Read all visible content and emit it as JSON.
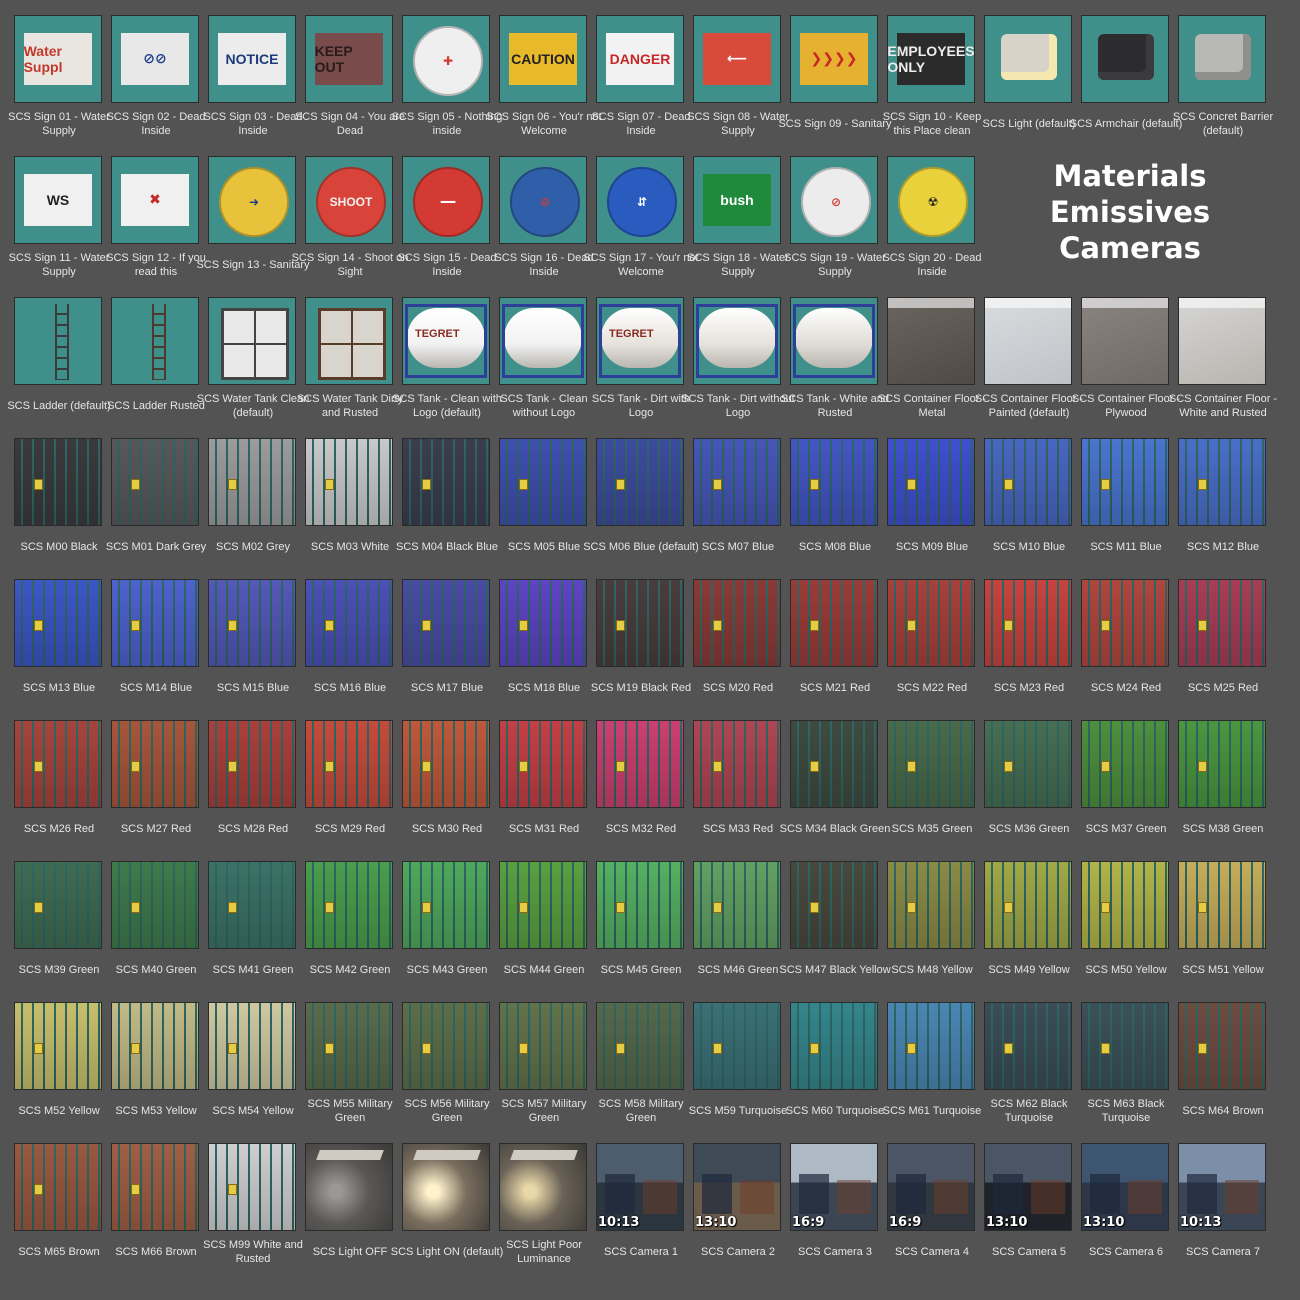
{
  "heading": [
    "Materials",
    "Emissives",
    "Cameras"
  ],
  "items": [
    {
      "label": "SCS Sign 01 - Water Supply",
      "kind": "sign-panel",
      "color": "#e9e6e1",
      "ink": "#c0392b",
      "text": "Water Suppl"
    },
    {
      "label": "SCS Sign 02 - Dead Inside",
      "kind": "sign-panel",
      "color": "#e8e8e8",
      "ink": "#1f3f8a",
      "text": "⊘⊘"
    },
    {
      "label": "SCS Sign 03 - Dead Inside",
      "kind": "sign-panel",
      "color": "#ececec",
      "ink": "#1d3a7a",
      "text": "NOTICE"
    },
    {
      "label": "SCS Sign 04 - You are Dead",
      "kind": "sign-panel",
      "color": "#7a4b4b",
      "ink": "#2a1b1b",
      "text": "KEEP OUT"
    },
    {
      "label": "SCS Sign 05 - Nothing inside",
      "kind": "sign-round",
      "color": "#efefef",
      "ink": "#d23b36",
      "text": "✚"
    },
    {
      "label": "SCS Sign 06 - You'r not Welcome",
      "kind": "sign-panel",
      "color": "#e8b92a",
      "ink": "#222",
      "text": "CAUTION"
    },
    {
      "label": "SCS Sign 07 - Dead Inside",
      "kind": "sign-panel",
      "color": "#f2f2f2",
      "ink": "#c62828",
      "text": "DANGER"
    },
    {
      "label": "SCS Sign 08 - Water Supply",
      "kind": "sign-panel",
      "color": "#d84a3a",
      "ink": "#ffffff",
      "text": "⟵"
    },
    {
      "label": "SCS Sign 09 - Sanitary",
      "kind": "sign-panel",
      "color": "#e6b130",
      "ink": "#c62828",
      "text": "❯❯❯❯"
    },
    {
      "label": "SCS Sign 10 - Keep this Place clean",
      "kind": "sign-panel",
      "color": "#2b2b2b",
      "ink": "#eeeeee",
      "text": "EMPLOYEES ONLY"
    },
    {
      "label": "SCS Light (default)",
      "kind": "thing",
      "color": "#d7d3c9",
      "ink": "#f4e7b0",
      "text": ""
    },
    {
      "label": "SCS Armchair (default)",
      "kind": "thing",
      "color": "#2c2c2e",
      "ink": "#3b3b3d",
      "text": ""
    },
    {
      "label": "SCS Concret Barrier (default)",
      "kind": "thing",
      "color": "#b8b8b5",
      "ink": "#8f8f8c",
      "text": ""
    },
    {
      "label": "SCS Sign 11 - Water Supply",
      "kind": "sign-panel",
      "color": "#f0f0f0",
      "ink": "#222",
      "text": "WS"
    },
    {
      "label": "SCS Sign 12 - If you read this",
      "kind": "sign-panel",
      "color": "#f0f0f0",
      "ink": "#c62828",
      "text": "✖"
    },
    {
      "label": "SCS Sign 13 - Sanitary",
      "kind": "sign-round",
      "color": "#e8c23a",
      "ink": "#1f3f8a",
      "text": "➜"
    },
    {
      "label": "SCS Sign 14 - Shoot on Sight",
      "kind": "sign-round",
      "color": "#d9443a",
      "ink": "#f2f2f2",
      "text": "SHOOT"
    },
    {
      "label": "SCS Sign 15 - Dead Inside",
      "kind": "sign-round",
      "color": "#d33a33",
      "ink": "#ffffff",
      "text": "━━"
    },
    {
      "label": "SCS Sign 16 - Dead Inside",
      "kind": "sign-round",
      "color": "#2f5fa8",
      "ink": "#d33a33",
      "text": "⊘"
    },
    {
      "label": "SCS Sign 17 - You'r not Welcome",
      "kind": "sign-round",
      "color": "#2a5cc0",
      "ink": "#ffffff",
      "text": "⇵"
    },
    {
      "label": "SCS Sign 18 - Water Supply",
      "kind": "sign-panel",
      "color": "#1f8a3c",
      "ink": "#ffffff",
      "text": "bush"
    },
    {
      "label": "SCS Sign 19 - Water Supply",
      "kind": "sign-round",
      "color": "#ececec",
      "ink": "#d33a33",
      "text": "⊘"
    },
    {
      "label": "SCS Sign 20 - Dead Inside",
      "kind": "sign-round",
      "color": "#e8d13a",
      "ink": "#222",
      "text": "☢"
    },
    {
      "label": "SCS Ladder (default)",
      "kind": "ladder",
      "color": "#3f8f8a",
      "ink": "#3b3b3b",
      "text": ""
    },
    {
      "label": "SCS Ladder Rusted",
      "kind": "ladder",
      "color": "#3f8f8a",
      "ink": "#4a3a30",
      "text": ""
    },
    {
      "label": "SCS Water Tank Clean (default)",
      "kind": "cage",
      "color": "#e9e9e9",
      "ink": "#444",
      "text": ""
    },
    {
      "label": "SCS Water Tank Dirty and Rusted",
      "kind": "cage",
      "color": "#d9d4cc",
      "ink": "#5a3a28",
      "text": ""
    },
    {
      "label": "SCS Tank - Clean with Logo (default)",
      "kind": "tank",
      "color": "#f2f2f2",
      "ink": "#2e3f9a",
      "text": "TEGRET"
    },
    {
      "label": "SCS Tank - Clean without Logo",
      "kind": "tank",
      "color": "#f2f2f2",
      "ink": "#2e3f9a",
      "text": ""
    },
    {
      "label": "SCS Tank - Dirt with Logo",
      "kind": "tank",
      "color": "#e6e2dc",
      "ink": "#2e3f9a",
      "text": "TEGRET"
    },
    {
      "label": "SCS Tank - Dirt without Logo",
      "kind": "tank",
      "color": "#e6e2dc",
      "ink": "#2e3f9a",
      "text": ""
    },
    {
      "label": "SCS Tank - White and Rusted",
      "kind": "tank",
      "color": "#e0dcd6",
      "ink": "#2e3f9a",
      "text": ""
    },
    {
      "label": "SCS Container Floor - Metal",
      "kind": "floor",
      "color": "#6b6560",
      "ink": "#4f4a45",
      "text": ""
    },
    {
      "label": "SCS Container Floor - Painted (default)",
      "kind": "floor",
      "color": "#d9dcdf",
      "ink": "#bfc3c7",
      "text": ""
    },
    {
      "label": "SCS Container Floor - Plywood",
      "kind": "floor",
      "color": "#8a8480",
      "ink": "#6f6a66",
      "text": ""
    },
    {
      "label": "SCS Container Floor - White and Rusted",
      "kind": "floor",
      "color": "#d6d6d6",
      "ink": "#b8b4ae",
      "text": ""
    },
    {
      "label": "SCS M00 Black",
      "kind": "container",
      "color": "#3a3a3c",
      "ink": "",
      "text": ""
    },
    {
      "label": "SCS M01 Dark Grey",
      "kind": "container",
      "color": "#58585a",
      "ink": "",
      "text": ""
    },
    {
      "label": "SCS M02 Grey",
      "kind": "container",
      "color": "#9c9c9c",
      "ink": "",
      "text": ""
    },
    {
      "label": "SCS M03 White",
      "kind": "container",
      "color": "#c9c9c9",
      "ink": "",
      "text": ""
    },
    {
      "label": "SCS M04 Black Blue",
      "kind": "container",
      "color": "#3b3d4f",
      "ink": "",
      "text": ""
    },
    {
      "label": "SCS M05 Blue",
      "kind": "container",
      "color": "#3f4fb0",
      "ink": "",
      "text": ""
    },
    {
      "label": "SCS M06 Blue (default)",
      "kind": "container",
      "color": "#3d4b9e",
      "ink": "",
      "text": ""
    },
    {
      "label": "SCS M07 Blue",
      "kind": "container",
      "color": "#4656b8",
      "ink": "",
      "text": ""
    },
    {
      "label": "SCS M08 Blue",
      "kind": "container",
      "color": "#4355c4",
      "ink": "",
      "text": ""
    },
    {
      "label": "SCS M09 Blue",
      "kind": "container",
      "color": "#3f4fd0",
      "ink": "",
      "text": ""
    },
    {
      "label": "SCS M10 Blue",
      "kind": "container",
      "color": "#4966c2",
      "ink": "",
      "text": ""
    },
    {
      "label": "SCS M11 Blue",
      "kind": "container",
      "color": "#4a74cf",
      "ink": "",
      "text": ""
    },
    {
      "label": "SCS M12 Blue",
      "kind": "container",
      "color": "#4a6ec8",
      "ink": "",
      "text": ""
    },
    {
      "label": "SCS M13 Blue",
      "kind": "container",
      "color": "#3c56c6",
      "ink": "",
      "text": ""
    },
    {
      "label": "SCS M14 Blue",
      "kind": "container",
      "color": "#4d62cc",
      "ink": "",
      "text": ""
    },
    {
      "label": "SCS M15 Blue",
      "kind": "container",
      "color": "#5458b8",
      "ink": "",
      "text": ""
    },
    {
      "label": "SCS M16 Blue",
      "kind": "container",
      "color": "#4c50b8",
      "ink": "",
      "text": ""
    },
    {
      "label": "SCS M17 Blue",
      "kind": "container",
      "color": "#4a4aa6",
      "ink": "",
      "text": ""
    },
    {
      "label": "SCS M18 Blue",
      "kind": "container",
      "color": "#5e44c4",
      "ink": "",
      "text": ""
    },
    {
      "label": "SCS M19 Black Red",
      "kind": "container",
      "color": "#4a3c3c",
      "ink": "",
      "text": ""
    },
    {
      "label": "SCS M20 Red",
      "kind": "container",
      "color": "#8a3a36",
      "ink": "",
      "text": ""
    },
    {
      "label": "SCS M21 Red",
      "kind": "container",
      "color": "#9a3b38",
      "ink": "",
      "text": ""
    },
    {
      "label": "SCS M22 Red",
      "kind": "container",
      "color": "#a8403a",
      "ink": "",
      "text": ""
    },
    {
      "label": "SCS M23 Red",
      "kind": "container",
      "color": "#c7433e",
      "ink": "",
      "text": ""
    },
    {
      "label": "SCS M24 Red",
      "kind": "container",
      "color": "#b0463e",
      "ink": "",
      "text": ""
    },
    {
      "label": "SCS M25 Red",
      "kind": "container",
      "color": "#a83d55",
      "ink": "",
      "text": ""
    },
    {
      "label": "SCS M26 Red",
      "kind": "container",
      "color": "#a6443c",
      "ink": "",
      "text": ""
    },
    {
      "label": "SCS M27 Red",
      "kind": "container",
      "color": "#a8553a",
      "ink": "",
      "text": ""
    },
    {
      "label": "SCS M28 Red",
      "kind": "container",
      "color": "#ab3f3a",
      "ink": "",
      "text": ""
    },
    {
      "label": "SCS M29 Red",
      "kind": "container",
      "color": "#c64b3c",
      "ink": "",
      "text": ""
    },
    {
      "label": "SCS M30 Red",
      "kind": "container",
      "color": "#c0583a",
      "ink": "",
      "text": ""
    },
    {
      "label": "SCS M31 Red",
      "kind": "container",
      "color": "#c43f45",
      "ink": "",
      "text": ""
    },
    {
      "label": "SCS M32 Red",
      "kind": "container",
      "color": "#cc3f6e",
      "ink": "",
      "text": ""
    },
    {
      "label": "SCS M33 Red",
      "kind": "container",
      "color": "#b04552",
      "ink": "",
      "text": ""
    },
    {
      "label": "SCS M34 Black Green",
      "kind": "container",
      "color": "#3e4a40",
      "ink": "",
      "text": ""
    },
    {
      "label": "SCS M35 Green",
      "kind": "container",
      "color": "#4a6a4a",
      "ink": "",
      "text": ""
    },
    {
      "label": "SCS M36 Green",
      "kind": "container",
      "color": "#476e52",
      "ink": "",
      "text": ""
    },
    {
      "label": "SCS M37 Green",
      "kind": "container",
      "color": "#4e8f3c",
      "ink": "",
      "text": ""
    },
    {
      "label": "SCS M38 Green",
      "kind": "container",
      "color": "#4a963e",
      "ink": "",
      "text": ""
    },
    {
      "label": "SCS M39 Green",
      "kind": "container",
      "color": "#3f6b52",
      "ink": "",
      "text": ""
    },
    {
      "label": "SCS M40 Green",
      "kind": "container",
      "color": "#3f7a4a",
      "ink": "",
      "text": ""
    },
    {
      "label": "SCS M41 Green",
      "kind": "container",
      "color": "#3c7266",
      "ink": "",
      "text": ""
    },
    {
      "label": "SCS M42 Green",
      "kind": "container",
      "color": "#4a9e4c",
      "ink": "",
      "text": ""
    },
    {
      "label": "SCS M43 Green",
      "kind": "container",
      "color": "#4fa85c",
      "ink": "",
      "text": ""
    },
    {
      "label": "SCS M44 Green",
      "kind": "container",
      "color": "#5aa040",
      "ink": "",
      "text": ""
    },
    {
      "label": "SCS M45 Green",
      "kind": "container",
      "color": "#55b061",
      "ink": "",
      "text": ""
    },
    {
      "label": "SCS M46 Green",
      "kind": "container",
      "color": "#62a062",
      "ink": "",
      "text": ""
    },
    {
      "label": "SCS M47 Black Yellow",
      "kind": "container",
      "color": "#48483e",
      "ink": "",
      "text": ""
    },
    {
      "label": "SCS M48 Yellow",
      "kind": "container",
      "color": "#8a8a46",
      "ink": "",
      "text": ""
    },
    {
      "label": "SCS M49 Yellow",
      "kind": "container",
      "color": "#a0a846",
      "ink": "",
      "text": ""
    },
    {
      "label": "SCS M50 Yellow",
      "kind": "container",
      "color": "#b2b448",
      "ink": "",
      "text": ""
    },
    {
      "label": "SCS M51 Yellow",
      "kind": "container",
      "color": "#c4ad5a",
      "ink": "",
      "text": ""
    },
    {
      "label": "SCS M52 Yellow",
      "kind": "container",
      "color": "#c8bf6c",
      "ink": "",
      "text": ""
    },
    {
      "label": "SCS M53 Yellow",
      "kind": "container",
      "color": "#c2ba86",
      "ink": "",
      "text": ""
    },
    {
      "label": "SCS M54 Yellow",
      "kind": "container",
      "color": "#cfc8a0",
      "ink": "",
      "text": ""
    },
    {
      "label": "SCS M55 Military Green",
      "kind": "container",
      "color": "#5a6a4a",
      "ink": "",
      "text": ""
    },
    {
      "label": "SCS M56 Military Green",
      "kind": "container",
      "color": "#5e6e48",
      "ink": "",
      "text": ""
    },
    {
      "label": "SCS M57 Military Green",
      "kind": "container",
      "color": "#62724a",
      "ink": "",
      "text": ""
    },
    {
      "label": "SCS M58 Military Green",
      "kind": "container",
      "color": "#56684a",
      "ink": "",
      "text": ""
    },
    {
      "label": "SCS M59 Turquoise",
      "kind": "container",
      "color": "#3a7076",
      "ink": "",
      "text": ""
    },
    {
      "label": "SCS M60 Turquoise",
      "kind": "container",
      "color": "#34868c",
      "ink": "",
      "text": ""
    },
    {
      "label": "SCS M61 Turquoise",
      "kind": "container",
      "color": "#4a86b4",
      "ink": "",
      "text": ""
    },
    {
      "label": "SCS M62 Black Turquoise",
      "kind": "container",
      "color": "#3b4c56",
      "ink": "",
      "text": ""
    },
    {
      "label": "SCS M63 Black Turquoise",
      "kind": "container",
      "color": "#3c5058",
      "ink": "",
      "text": ""
    },
    {
      "label": "SCS M64 Brown",
      "kind": "container",
      "color": "#6e4c40",
      "ink": "",
      "text": ""
    },
    {
      "label": "SCS M65 Brown",
      "kind": "container",
      "color": "#9a5840",
      "ink": "",
      "text": ""
    },
    {
      "label": "SCS M66 Brown",
      "kind": "container",
      "color": "#a05e44",
      "ink": "",
      "text": ""
    },
    {
      "label": "SCS M99 White and Rusted",
      "kind": "container",
      "color": "#cfcfcf",
      "ink": "",
      "text": ""
    },
    {
      "label": "SCS Light OFF",
      "kind": "light",
      "color": "#5a5856",
      "ink": "#9a9894",
      "text": ""
    },
    {
      "label": "SCS Light ON (default)",
      "kind": "light",
      "color": "#7a6e5e",
      "ink": "#fff2cc",
      "text": ""
    },
    {
      "label": "SCS Light Poor Luminance",
      "kind": "light",
      "color": "#6a6256",
      "ink": "#e9d7a8",
      "text": ""
    },
    {
      "label": "SCS Camera 1",
      "kind": "camera",
      "color": "#4d5d6e",
      "ink": "#2c3640",
      "text": "10:13"
    },
    {
      "label": "SCS Camera 2",
      "kind": "camera",
      "color": "#3f4a57",
      "ink": "#6a5b4b",
      "text": "13:10"
    },
    {
      "label": "SCS Camera 3",
      "kind": "camera",
      "color": "#aeb9c6",
      "ink": "#3c4652",
      "text": "16:9"
    },
    {
      "label": "SCS Camera 4",
      "kind": "camera",
      "color": "#4b5565",
      "ink": "#31373f",
      "text": "16:9"
    },
    {
      "label": "SCS Camera 5",
      "kind": "camera",
      "color": "#4a5566",
      "ink": "#1f2329",
      "text": "13:10"
    },
    {
      "label": "SCS Camera 6",
      "kind": "camera",
      "color": "#3d5570",
      "ink": "#2d3748",
      "text": "13:10"
    },
    {
      "label": "SCS Camera 7",
      "kind": "camera",
      "color": "#7c8fa8",
      "ink": "#3b4654",
      "text": "10:13"
    }
  ]
}
